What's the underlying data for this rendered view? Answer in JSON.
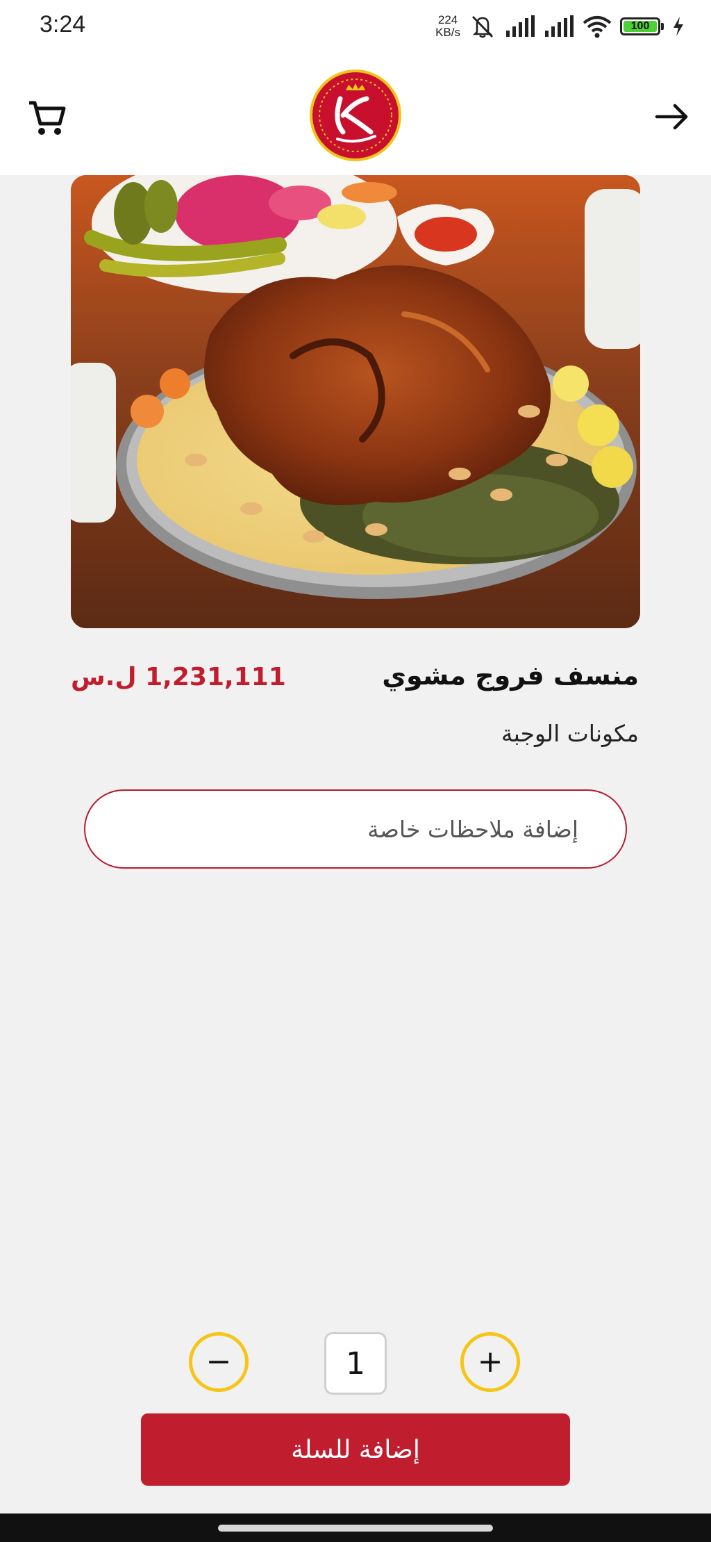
{
  "status_bar": {
    "time": "3:24",
    "net_speed_value": "224",
    "net_speed_unit": "KB/s",
    "battery": "100",
    "icons": [
      "mute-icon",
      "signal-icon",
      "signal-icon",
      "wifi-icon",
      "battery-icon",
      "charging-icon"
    ]
  },
  "header": {
    "cart_icon": "cart-icon",
    "back_icon": "arrow-right-icon",
    "logo_icon": "restaurant-logo"
  },
  "product": {
    "name": "منسف فروج مشوي",
    "price": "1,231,111 ل.س",
    "ingredients_label": "مكونات الوجبة",
    "image": "grilled-chicken-mansaf-photo"
  },
  "notes": {
    "placeholder": "إضافة ملاحظات خاصة"
  },
  "quantity": {
    "value": "1",
    "minus_label": "−",
    "plus_label": "+"
  },
  "add_to_cart_label": "إضافة للسلة",
  "colors": {
    "primary": "#c01d2e",
    "accent": "#f5c518",
    "background": "#f1f1f1"
  }
}
